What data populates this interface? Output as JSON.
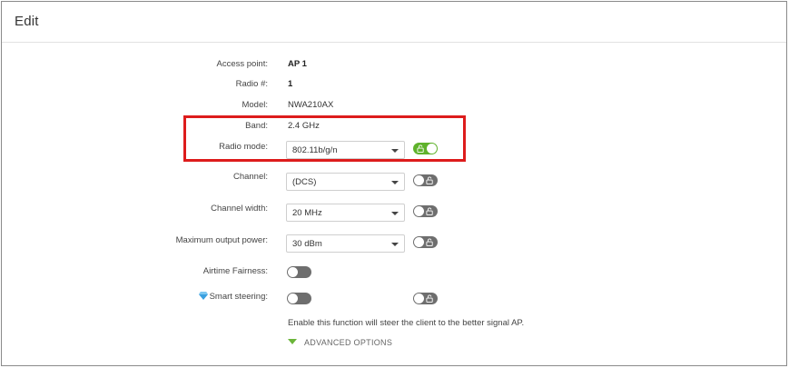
{
  "header": {
    "title": "Edit"
  },
  "fields": {
    "access_point": {
      "label": "Access point:",
      "value": "AP 1"
    },
    "radio_num": {
      "label": "Radio #:",
      "value": "1"
    },
    "model": {
      "label": "Model:",
      "value": "NWA210AX"
    },
    "band": {
      "label": "Band:",
      "value": "2.4 GHz"
    },
    "radio_mode": {
      "label": "Radio mode:",
      "value": "802.11b/g/n",
      "override": true
    },
    "channel": {
      "label": "Channel:",
      "value": "(DCS)",
      "override": false
    },
    "channel_width": {
      "label": "Channel width:",
      "value": "20 MHz",
      "override": false
    },
    "max_output_power": {
      "label": "Maximum output power:",
      "value": "30 dBm",
      "override": false
    },
    "airtime_fairness": {
      "label": "Airtime Fairness:",
      "enabled": false
    },
    "smart_steering": {
      "label": "Smart steering:",
      "enabled": false,
      "override": false
    }
  },
  "help_text": "Enable this function will steer the client to the better signal AP.",
  "advanced_options": "ADVANCED OPTIONS",
  "colors": {
    "toggle_on": "#5fb22b",
    "toggle_off": "#6e6e6e",
    "highlight": "#dd1c1c",
    "accent_triangle": "#6bb53a",
    "gem": "#3aa0e0"
  },
  "icons": {
    "override": "unlock-icon",
    "advanced": "triangle-down-icon",
    "premium": "diamond-icon",
    "dropdown": "chevron-down-icon"
  }
}
